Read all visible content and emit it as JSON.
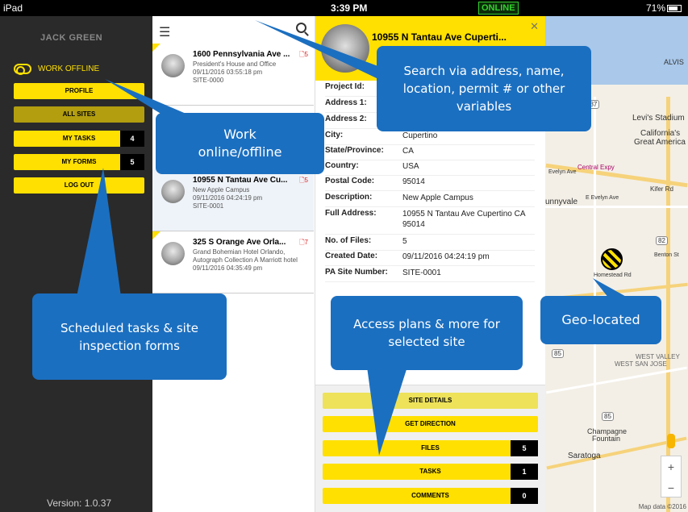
{
  "status_bar": {
    "device": "iPad",
    "time": "3:39 PM",
    "connection": "ONLINE",
    "battery": "71%"
  },
  "sidebar": {
    "user": "JACK GREEN",
    "offline_label": "WORK OFFLINE",
    "buttons": [
      {
        "label": "PROFILE"
      },
      {
        "label": "ALL SITES"
      },
      {
        "label": "MY TASKS",
        "count": "4"
      },
      {
        "label": "MY FORMS",
        "count": "5"
      },
      {
        "label": "LOG OUT"
      }
    ],
    "version": "Version: 1.0.37"
  },
  "site_list": [
    {
      "name": "1600 Pennsylvania Ave ...",
      "files": "5",
      "desc": "President's House and Office",
      "date": "09/11/2016 03:55:18 pm",
      "site": "SITE-0000"
    },
    {
      "name": "10955 N Tantau Ave Cu...",
      "files": "5",
      "desc": "New Apple Campus",
      "date": "09/11/2016 04:24:19 pm",
      "site": "SITE-0001"
    },
    {
      "name": "325 S Orange Ave Orla...",
      "files": "7",
      "desc": "Grand Bohemian Hotel Orlando, Autograph Collection A Marriott hotel",
      "date": "09/11/2016 04:35:49 pm",
      "site": ""
    }
  ],
  "detail": {
    "title": "10955 N Tantau Ave Cuperti...",
    "fields": [
      {
        "label": "Project Id:",
        "value": ""
      },
      {
        "label": "Address 1:",
        "value": ""
      },
      {
        "label": "Address 2:",
        "value": ""
      },
      {
        "label": "City:",
        "value": "Cupertino"
      },
      {
        "label": "State/Province:",
        "value": "CA"
      },
      {
        "label": "Country:",
        "value": "USA"
      },
      {
        "label": "Postal Code:",
        "value": "95014"
      },
      {
        "label": "Description:",
        "value": "New Apple Campus"
      },
      {
        "label": "Full Address:",
        "value": "10955 N Tantau Ave Cupertino CA 95014"
      },
      {
        "label": "No. of Files:",
        "value": "5"
      },
      {
        "label": "Created Date:",
        "value": "09/11/2016 04:24:19 pm"
      },
      {
        "label": "PA Site Number:",
        "value": "SITE-0001"
      }
    ],
    "buttons": [
      {
        "label": "SITE DETAILS"
      },
      {
        "label": "GET DIRECTION"
      },
      {
        "label": "FILES",
        "count": "5"
      },
      {
        "label": "TASKS",
        "count": "1"
      },
      {
        "label": "COMMENTS",
        "count": "0"
      }
    ]
  },
  "map": {
    "labels": [
      "ALVIS",
      "Levi's Stadium",
      "California's",
      "Great America",
      "Central Expy",
      "Kifer Rd",
      "E Evelyn Ave",
      "unnyvale",
      "Benton St",
      "Homestead Rd",
      "WEST VALLEY",
      "WEST SAN JOSE",
      "Champagne",
      "Fountain",
      "Saratoga",
      "Evelyn Ave"
    ],
    "shields": [
      "237",
      "82",
      "85",
      "85"
    ],
    "zoom_in": "+",
    "zoom_out": "−",
    "attribution": "Map data ©2016"
  },
  "callouts": {
    "search": "Search via address, name, location, permit # or other variables",
    "offline": "Work online/offline",
    "scheduled": "Scheduled tasks & site inspection forms",
    "access": "Access plans & more for selected site",
    "geo": "Geo-located"
  },
  "colors": {
    "accent": "#ffe000",
    "callout": "#1b6fc0",
    "sidebar": "#2a2a2a",
    "online": "#35d02f"
  }
}
